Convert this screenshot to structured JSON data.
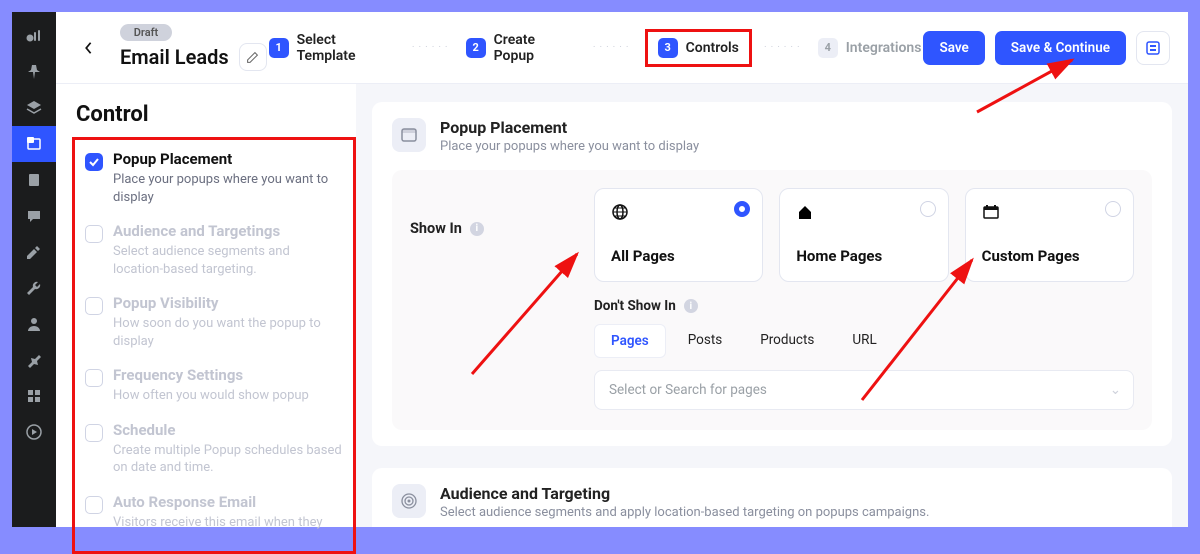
{
  "header": {
    "chip": "Draft",
    "title": "Email Leads",
    "save": "Save",
    "save_continue": "Save & Continue"
  },
  "steps": [
    {
      "num": "1",
      "label": "Select Template"
    },
    {
      "num": "2",
      "label": "Create Popup"
    },
    {
      "num": "3",
      "label": "Controls"
    },
    {
      "num": "4",
      "label": "Integrations"
    }
  ],
  "side_heading": "Control",
  "side_items": [
    {
      "title": "Popup Placement",
      "desc": "Place your popups where you want to display"
    },
    {
      "title": "Audience and Targetings",
      "desc": "Select audience segments and location-based targeting."
    },
    {
      "title": "Popup Visibility",
      "desc": "How soon do you want the popup to display"
    },
    {
      "title": "Frequency Settings",
      "desc": "How often you would show popup"
    },
    {
      "title": "Schedule",
      "desc": "Create multiple Popup schedules based on date and time."
    },
    {
      "title": "Auto Response Email",
      "desc": "Visitors receive this email when they"
    }
  ],
  "placement_card": {
    "title": "Popup Placement",
    "sub": "Place your popups where you want to display",
    "show_in": "Show In",
    "options": [
      "All Pages",
      "Home Pages",
      "Custom Pages"
    ],
    "dont_show_in": "Don't Show In",
    "tabs": [
      "Pages",
      "Posts",
      "Products",
      "URL"
    ],
    "select_placeholder": "Select or Search for pages"
  },
  "audience_card": {
    "title": "Audience and Targeting",
    "sub": "Select audience segments and apply location-based targeting on popups campaigns."
  }
}
